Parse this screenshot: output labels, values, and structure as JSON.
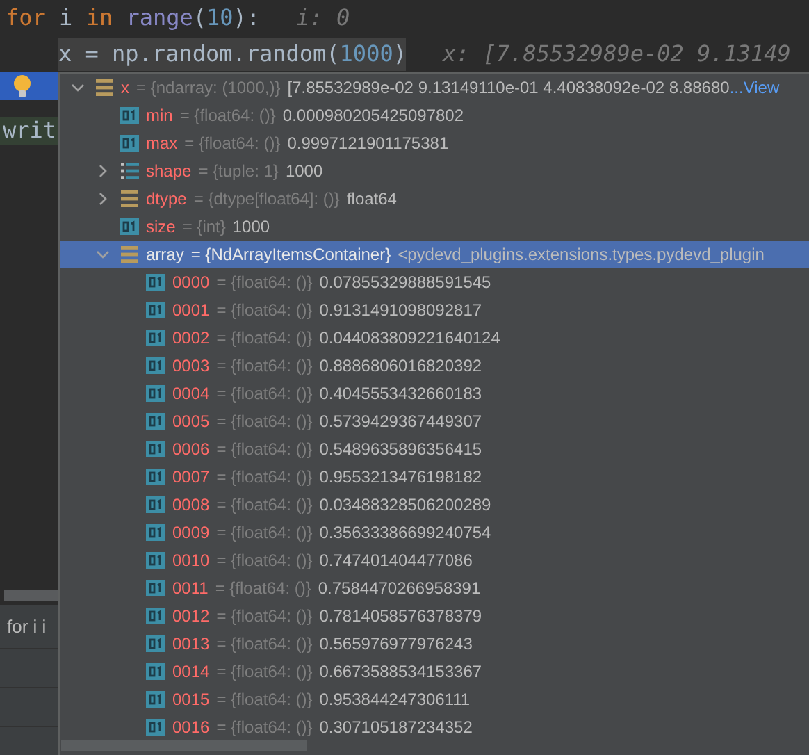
{
  "editor": {
    "lines": [
      {
        "tokens": [
          {
            "kind": "keyword",
            "text": "for"
          },
          {
            "kind": "name",
            "text": " i "
          },
          {
            "kind": "keyword",
            "text": "in"
          },
          {
            "kind": "builtin",
            "text": " range"
          },
          {
            "kind": "punct",
            "text": "("
          },
          {
            "kind": "number",
            "text": "10"
          },
          {
            "kind": "punct",
            "text": "):"
          }
        ],
        "hint": "i: 0",
        "current": false
      },
      {
        "tokens": [
          {
            "kind": "name",
            "text": "x = np.random.random("
          },
          {
            "kind": "number",
            "text": "1000"
          },
          {
            "kind": "name",
            "text": ")"
          }
        ],
        "hint": "x: [7.85532989e-02 9.13149",
        "current": true
      }
    ]
  },
  "gutter": {
    "code_fragment": "writ",
    "tab_label": "for i i"
  },
  "variables": [
    {
      "name": "x",
      "type": "= {ndarray: (1000,)}",
      "value": "[7.85532989e-02 9.13149110e-01 4.40838092e-02 8.88680",
      "link": "...View",
      "kind": "list",
      "expanded": true,
      "selected": false,
      "children": [
        {
          "name": "min",
          "type": "= {float64: ()}",
          "value": "0.000980205425097802",
          "kind": "primitive",
          "selected": false
        },
        {
          "name": "max",
          "type": "= {float64: ()}",
          "value": "0.9997121901175381",
          "kind": "primitive",
          "selected": false
        },
        {
          "name": "shape",
          "type": "= {tuple: 1}",
          "value": "1000",
          "kind": "tuple",
          "expanded": false,
          "selected": false
        },
        {
          "name": "dtype",
          "type": "= {dtype[float64]: ()}",
          "value": "float64",
          "kind": "list",
          "expanded": false,
          "selected": false
        },
        {
          "name": "size",
          "type": "= {int}",
          "value": "1000",
          "kind": "primitive",
          "selected": false
        },
        {
          "name": "array",
          "type": "= {NdArrayItemsContainer}",
          "value": "<pydevd_plugins.extensions.types.pydevd_plugin",
          "kind": "list",
          "expanded": true,
          "selected": true,
          "children": [
            {
              "name": "0000",
              "type": "= {float64: ()}",
              "value": "0.07855329888591545",
              "kind": "primitive",
              "selected": false
            },
            {
              "name": "0001",
              "type": "= {float64: ()}",
              "value": "0.9131491098092817",
              "kind": "primitive",
              "selected": false
            },
            {
              "name": "0002",
              "type": "= {float64: ()}",
              "value": "0.044083809221640124",
              "kind": "primitive",
              "selected": false
            },
            {
              "name": "0003",
              "type": "= {float64: ()}",
              "value": "0.8886806016820392",
              "kind": "primitive",
              "selected": false
            },
            {
              "name": "0004",
              "type": "= {float64: ()}",
              "value": "0.4045553432660183",
              "kind": "primitive",
              "selected": false
            },
            {
              "name": "0005",
              "type": "= {float64: ()}",
              "value": "0.5739429367449307",
              "kind": "primitive",
              "selected": false
            },
            {
              "name": "0006",
              "type": "= {float64: ()}",
              "value": "0.5489635896356415",
              "kind": "primitive",
              "selected": false
            },
            {
              "name": "0007",
              "type": "= {float64: ()}",
              "value": "0.9553213476198182",
              "kind": "primitive",
              "selected": false
            },
            {
              "name": "0008",
              "type": "= {float64: ()}",
              "value": "0.03488328506200289",
              "kind": "primitive",
              "selected": false
            },
            {
              "name": "0009",
              "type": "= {float64: ()}",
              "value": "0.35633386699240754",
              "kind": "primitive",
              "selected": false
            },
            {
              "name": "0010",
              "type": "= {float64: ()}",
              "value": "0.747401404477086",
              "kind": "primitive",
              "selected": false
            },
            {
              "name": "0011",
              "type": "= {float64: ()}",
              "value": "0.7584470266958391",
              "kind": "primitive",
              "selected": false
            },
            {
              "name": "0012",
              "type": "= {float64: ()}",
              "value": "0.7814058576378379",
              "kind": "primitive",
              "selected": false
            },
            {
              "name": "0013",
              "type": "= {float64: ()}",
              "value": "0.565976977976243",
              "kind": "primitive",
              "selected": false
            },
            {
              "name": "0014",
              "type": "= {float64: ()}",
              "value": "0.6673588534153367",
              "kind": "primitive",
              "selected": false
            },
            {
              "name": "0015",
              "type": "= {float64: ()}",
              "value": "0.953844247306111",
              "kind": "primitive",
              "selected": false
            },
            {
              "name": "0016",
              "type": "= {float64: ()}",
              "value": "0.307105187234352",
              "kind": "primitive",
              "selected": false
            }
          ]
        }
      ]
    }
  ]
}
